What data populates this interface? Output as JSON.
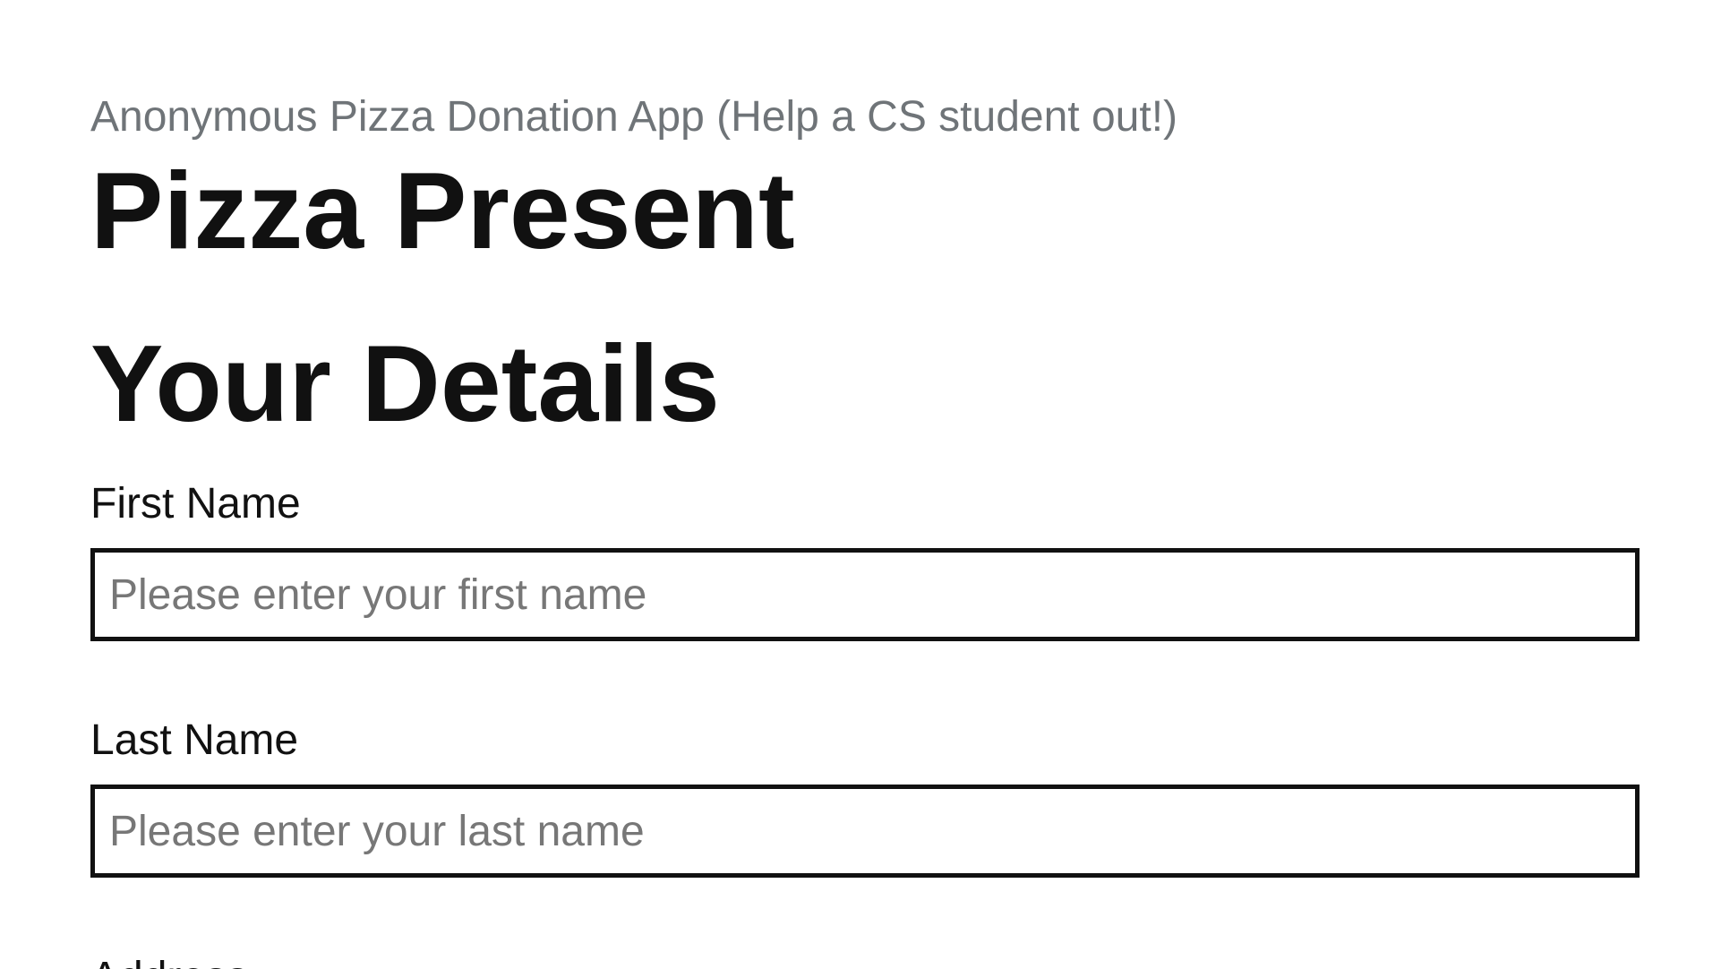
{
  "header": {
    "tagline": "Anonymous Pizza Donation App (Help a CS student out!)",
    "app_title": "Pizza Present"
  },
  "form": {
    "section_title": "Your Details",
    "fields": [
      {
        "label": "First Name",
        "value": "",
        "placeholder": "Please enter your first name"
      },
      {
        "label": "Last Name",
        "value": "",
        "placeholder": "Please enter your last name"
      },
      {
        "label": "Address"
      }
    ]
  }
}
